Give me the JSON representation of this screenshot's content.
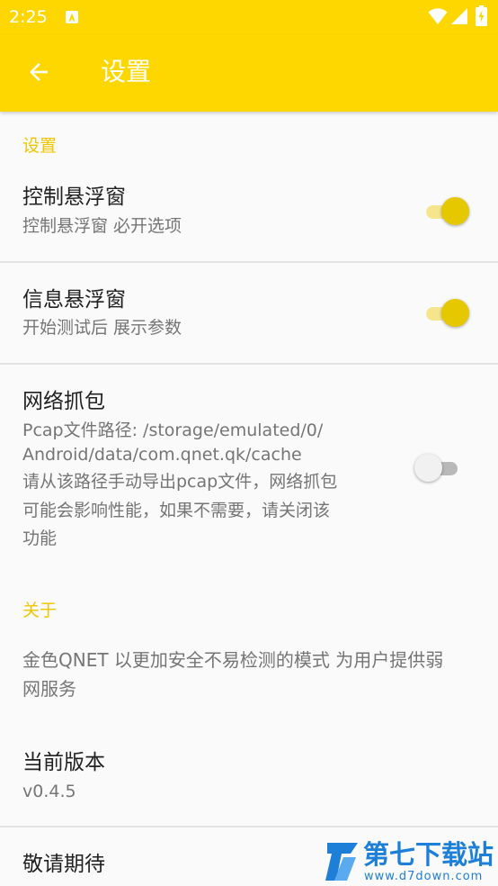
{
  "status_bar": {
    "time": "2:25",
    "icons": [
      "notification-a-icon",
      "wifi-icon",
      "signal-icon",
      "battery-charging-icon"
    ]
  },
  "app_bar": {
    "back_icon": "arrow-left-icon",
    "title": "设置"
  },
  "sections": {
    "settings": {
      "header": "设置",
      "items": [
        {
          "title": "控制悬浮窗",
          "summary": "控制悬浮窗 必开选项",
          "switch_on": true
        },
        {
          "title": "信息悬浮窗",
          "summary": "开始测试后 展示参数",
          "switch_on": true
        },
        {
          "title": "网络抓包",
          "summary_lines": [
            "Pcap文件路径: /storage/emulated/0/",
            "Android/data/com.qnet.qk/cache",
            "请从该路径手动导出pcap文件，网络抓包",
            "可能会影响性能，如果不需要，请关闭该",
            "功能"
          ],
          "switch_on": false
        }
      ]
    },
    "about": {
      "header": "关于",
      "description_lines": [
        "金色QNET 以更加安全不易检测的模式 为用户提供弱",
        "网服务"
      ],
      "version": {
        "title": "当前版本",
        "value": "v0.4.5"
      },
      "more": {
        "title": "敬请期待"
      }
    }
  },
  "watermark": {
    "name": "第七下载站",
    "url": "www.d7down.com"
  },
  "colors": {
    "primary": "#ffd700",
    "accent": "#e6c800",
    "category_text": "#f0c400",
    "watermark": "#1e7fd8"
  }
}
